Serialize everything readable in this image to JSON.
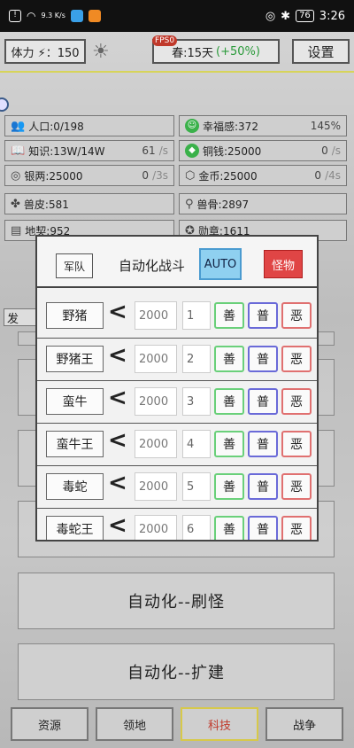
{
  "statusbar": {
    "net_speed": "9.3 K/s",
    "battery": "76",
    "time": "3:26"
  },
  "header": {
    "stamina_label": "体力 ⚡：150",
    "fps": "FPS0",
    "season": "春:15天",
    "season_bonus": "(+50%)",
    "settings_label": "设置"
  },
  "stats": [
    {
      "label": "人口:0/198",
      "value": "",
      "rate": "",
      "icon": "people-icon"
    },
    {
      "label": "幸福感:372",
      "value": "145%",
      "rate": "",
      "icon": "smile-icon"
    },
    {
      "label": "知识:13W/14W",
      "value": "61",
      "rate": "/s",
      "icon": "book-icon"
    },
    {
      "label": "铜钱:25000",
      "value": "0",
      "rate": "/s",
      "icon": "copper-coin-icon"
    },
    {
      "label": "银两:25000",
      "value": "0",
      "rate": "/3s",
      "icon": "silver-icon"
    },
    {
      "label": "金币:25000",
      "value": "0",
      "rate": "/4s",
      "icon": "gold-icon"
    },
    {
      "label": "兽皮:581",
      "value": "",
      "rate": "",
      "icon": "hide-icon"
    },
    {
      "label": "兽骨:2897",
      "value": "",
      "rate": "",
      "icon": "bone-icon"
    },
    {
      "label": "地契:952",
      "value": "",
      "rate": "",
      "icon": "deed-icon"
    },
    {
      "label": "勋章:1611",
      "value": "",
      "rate": "",
      "icon": "medal-icon"
    }
  ],
  "dev_tab": "发",
  "modal": {
    "army_label": "军队",
    "title": "自动化战斗",
    "auto_label": "AUTO",
    "monster_label": "怪物",
    "compare": "<",
    "good_label": "善",
    "normal_label": "普",
    "evil_label": "恶",
    "rows": [
      {
        "name": "野猪",
        "amount": "2000",
        "level": "1"
      },
      {
        "name": "野猪王",
        "amount": "2000",
        "level": "2"
      },
      {
        "name": "蛮牛",
        "amount": "2000",
        "level": "3"
      },
      {
        "name": "蛮牛王",
        "amount": "2000",
        "level": "4"
      },
      {
        "name": "毒蛇",
        "amount": "2000",
        "level": "5"
      },
      {
        "name": "毒蛇王",
        "amount": "2000",
        "level": "6"
      }
    ]
  },
  "buttons": {
    "auto_farm": "自动化--刷怪",
    "auto_build": "自动化--扩建"
  },
  "nav": {
    "resources": "资源",
    "territory": "领地",
    "tech": "科技",
    "war": "战争"
  }
}
